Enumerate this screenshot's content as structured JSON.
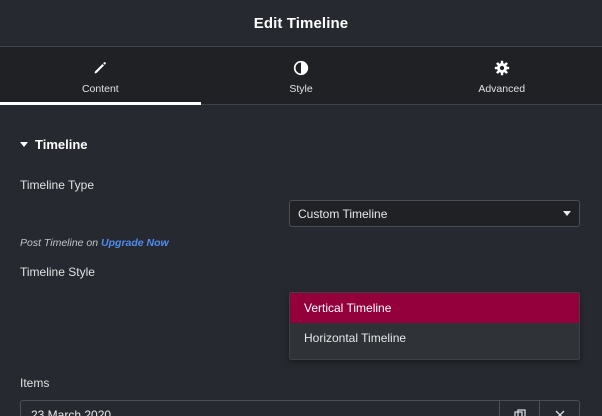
{
  "header": {
    "title": "Edit Timeline"
  },
  "tabs": [
    {
      "label": "Content",
      "icon": "pencil-icon",
      "active": true
    },
    {
      "label": "Style",
      "icon": "half-circle-icon",
      "active": false
    },
    {
      "label": "Advanced",
      "icon": "gear-icon",
      "active": false
    }
  ],
  "section": {
    "title": "Timeline"
  },
  "timeline_type": {
    "label": "Timeline Type",
    "value": "Custom Timeline"
  },
  "note": {
    "prefix": "Post Timeline on ",
    "link": "Upgrade Now"
  },
  "timeline_style": {
    "label": "Timeline Style",
    "options": [
      {
        "label": "Vertical Timeline",
        "selected": true
      },
      {
        "label": "Horizontal Timeline",
        "selected": false
      }
    ]
  },
  "items": {
    "label": "Items",
    "first_item": "23 March 2020"
  },
  "colors": {
    "accent": "#93003c",
    "link": "#4e8cf0",
    "background": "#26292f"
  }
}
